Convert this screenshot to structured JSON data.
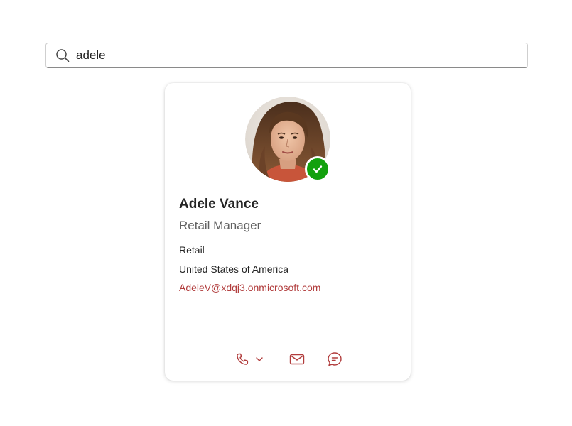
{
  "search": {
    "value": "adele",
    "icon": "search-icon"
  },
  "contact_card": {
    "name": "Adele Vance",
    "job_title": "Retail Manager",
    "department": "Retail",
    "location": "United States of America",
    "email": "AdeleV@xdqj3.onmicrosoft.com",
    "presence": "available",
    "actions": [
      {
        "icon": "phone-icon",
        "has_dropdown": true
      },
      {
        "icon": "mail-icon"
      },
      {
        "icon": "chat-icon"
      }
    ]
  },
  "colors": {
    "accent": "#b13c3c",
    "presence_available": "#13a10e",
    "text_primary": "#242424",
    "text_secondary": "#616161"
  }
}
